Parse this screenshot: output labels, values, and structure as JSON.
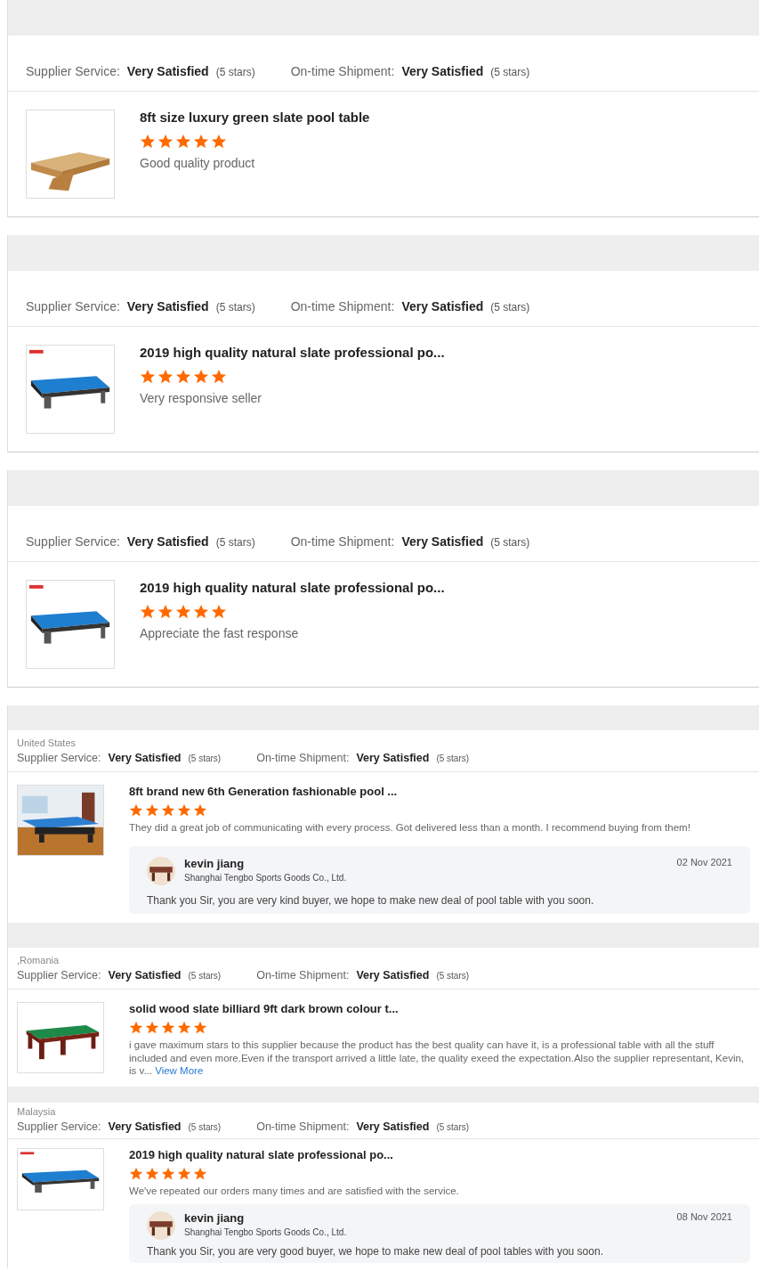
{
  "reviews": [
    {
      "ratings": [
        {
          "label": "Supplier Service:",
          "value": "Very Satisfied",
          "stars_text": "(5 stars)"
        },
        {
          "label": "On-time Shipment:",
          "value": "Very Satisfied",
          "stars_text": "(5 stars)"
        }
      ],
      "product": {
        "title": "8ft size luxury green slate pool table",
        "stars": 5,
        "comment": "Good quality product"
      }
    },
    {
      "ratings": [
        {
          "label": "Supplier Service:",
          "value": "Very Satisfied",
          "stars_text": "(5 stars)"
        },
        {
          "label": "On-time Shipment:",
          "value": "Very Satisfied",
          "stars_text": "(5 stars)"
        }
      ],
      "product": {
        "title": "2019 high quality natural slate professional po...",
        "stars": 5,
        "comment": "Very responsive seller"
      }
    },
    {
      "ratings": [
        {
          "label": "Supplier Service:",
          "value": "Very Satisfied",
          "stars_text": "(5 stars)"
        },
        {
          "label": "On-time Shipment:",
          "value": "Very Satisfied",
          "stars_text": "(5 stars)"
        }
      ],
      "product": {
        "title": "2019 high quality natural slate professional po...",
        "stars": 5,
        "comment": "Appreciate the fast response"
      }
    },
    {
      "location": "United States",
      "ratings": [
        {
          "label": "Supplier Service:",
          "value": "Very Satisfied",
          "stars_text": "(5 stars)"
        },
        {
          "label": "On-time Shipment:",
          "value": "Very Satisfied",
          "stars_text": "(5 stars)"
        }
      ],
      "product": {
        "title": "8ft brand new 6th Generation fashionable pool ...",
        "stars": 5,
        "comment": "They did a great job of communicating with every process. Got delivered less than a month. I recommend buying from them!"
      },
      "reply": {
        "name": "kevin jiang",
        "company": "Shanghai Tengbo Sports Goods Co., Ltd.",
        "date": "02 Nov 2021",
        "text": "Thank you Sir, you are very kind buyer, we hope to make new deal of pool table with you soon."
      }
    },
    {
      "location": ",Romania",
      "ratings": [
        {
          "label": "Supplier Service:",
          "value": "Very Satisfied",
          "stars_text": "(5 stars)"
        },
        {
          "label": "On-time Shipment:",
          "value": "Very Satisfied",
          "stars_text": "(5 stars)"
        }
      ],
      "product": {
        "title": "solid wood slate billiard 9ft dark brown colour t...",
        "stars": 5,
        "comment": "i gave maximum stars to this supplier because the product has the best quality can have it, is a professional table with all the stuff included and even more.Even if the transport arrived a little late, the quality exeed the expectation.Also the supplier representant, Kevin, is v...",
        "view_more": "View More"
      }
    },
    {
      "location": "Malaysia",
      "ratings": [
        {
          "label": "Supplier Service:",
          "value": "Very Satisfied",
          "stars_text": "(5 stars)"
        },
        {
          "label": "On-time Shipment:",
          "value": "Very Satisfied",
          "stars_text": "(5 stars)"
        }
      ],
      "product": {
        "title": "2019 high quality natural slate professional po...",
        "stars": 5,
        "comment": "We've repeated our orders many times and are satisfied with the service."
      },
      "reply": {
        "name": "kevin jiang",
        "company": "Shanghai Tengbo Sports Goods Co., Ltd.",
        "date": "08 Nov 2021",
        "text": "Thank you Sir, you are very good buyer, we hope to make new deal of pool tables with you soon."
      }
    }
  ]
}
